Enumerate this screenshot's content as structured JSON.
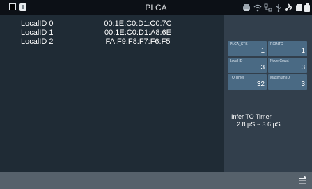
{
  "header": {
    "title": "PLCA"
  },
  "local_ids": [
    {
      "label": "LocalID 0",
      "mac": "00:1E:C0:D1:C0:7C"
    },
    {
      "label": "LocalID 1",
      "mac": "00:1E:C0:D1:A8:6E"
    },
    {
      "label": "LocalID 2",
      "mac": "FA:F9:F8:F7:F6:F5"
    }
  ],
  "status_cells": [
    {
      "label": "PLCA_STS",
      "value": "1"
    },
    {
      "label": "RXINTO",
      "value": "1"
    },
    {
      "label": "Local ID",
      "value": "3"
    },
    {
      "label": "Node Count",
      "value": "3"
    },
    {
      "label": "TO Timer",
      "value": "32"
    },
    {
      "label": "Maximum ID",
      "value": "3"
    }
  ],
  "infer": {
    "title": "Infer TO Timer",
    "value": "2.8 µS ~ 3.6 µS"
  },
  "icons": {
    "left": [
      "stop-square-icon",
      "sd-card-icon"
    ],
    "right": [
      "printer-icon",
      "wifi-icon",
      "network-icon",
      "usb-icon",
      "bluetooth-icon",
      "storage-icon",
      "battery-icon"
    ],
    "bottom": "menu-icon"
  },
  "colors": {
    "background": "#1f2b35",
    "panel": "#323f4c",
    "cell": "#4a6a84",
    "topbar": "#0c1016",
    "bottombar": "#56616b"
  }
}
